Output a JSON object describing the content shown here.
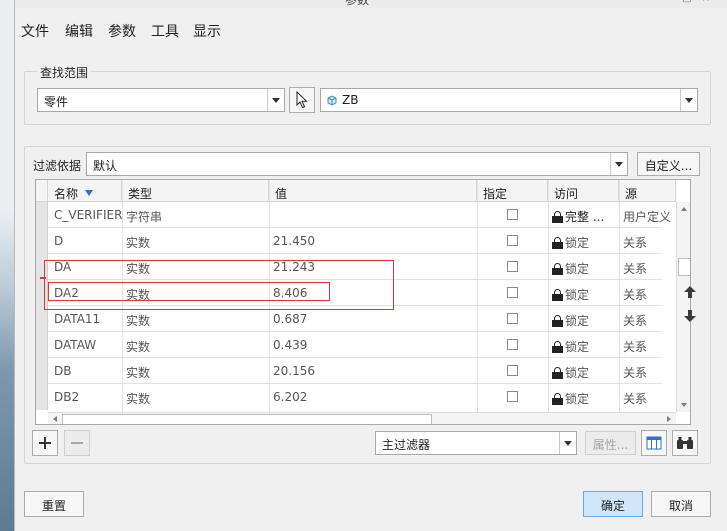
{
  "window": {
    "title": "参数"
  },
  "menu": [
    "文件",
    "编辑",
    "参数",
    "工具",
    "显示"
  ],
  "scope": {
    "legend": "查找范围",
    "type_value": "零件",
    "model_value": "ZB"
  },
  "filter": {
    "label": "过滤依据",
    "value": "默认",
    "customize_label": "自定义..."
  },
  "table": {
    "columns": [
      "名称",
      "类型",
      "值",
      "指定",
      "访问",
      "源"
    ],
    "rows": [
      {
        "name": "C_VERIFIER",
        "type": "字符串",
        "value": "",
        "access": "完整",
        "source": "用户定义"
      },
      {
        "name": "D",
        "type": "实数",
        "value": "21.450",
        "access": "锁定",
        "source": "关系"
      },
      {
        "name": "DA",
        "type": "实数",
        "value": "21.243",
        "access": "锁定",
        "source": "关系"
      },
      {
        "name": "DA2",
        "type": "实数",
        "value": "8.406",
        "access": "锁定",
        "source": "关系"
      },
      {
        "name": "DATA11",
        "type": "实数",
        "value": "0.687",
        "access": "锁定",
        "source": "关系"
      },
      {
        "name": "DATAW",
        "type": "实数",
        "value": "0.439",
        "access": "锁定",
        "source": "关系"
      },
      {
        "name": "DB",
        "type": "实数",
        "value": "20.156",
        "access": "锁定",
        "source": "关系"
      },
      {
        "name": "DB2",
        "type": "实数",
        "value": "6.202",
        "access": "锁定",
        "source": "关系"
      }
    ]
  },
  "bottom": {
    "main_filter": "主过滤器",
    "properties_label": "属性..."
  },
  "footer": {
    "reset": "重置",
    "ok": "确定",
    "cancel": "取消"
  }
}
